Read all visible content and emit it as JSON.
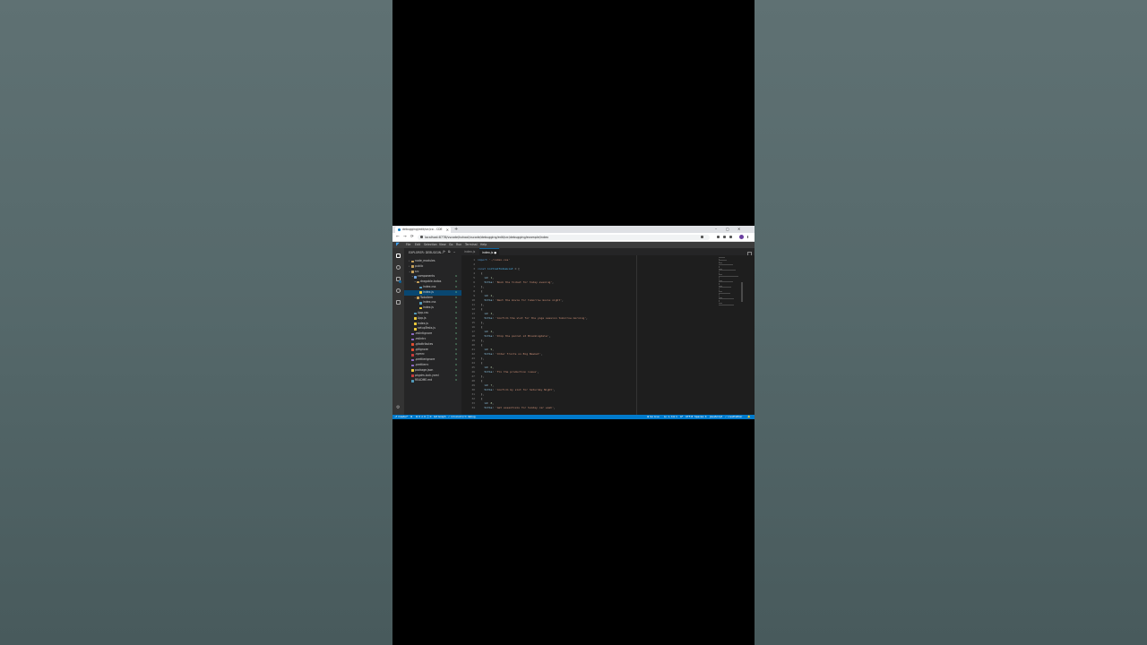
{
  "browser": {
    "tab_title": "debugging/edit/src/co - CDE",
    "new_tab": "+",
    "url": "localhost:8778/vscode/kuhool/vscode/debugging/edit/src/debugging/example/index",
    "controls": {
      "minimize": "–",
      "maximize": "▢",
      "close": "✕",
      "back": "←",
      "forward": "→",
      "reload": "⟳"
    }
  },
  "vscode": {
    "menu": [
      "File",
      "Edit",
      "Selection",
      "View",
      "Go",
      "Run",
      "Terminal",
      "Help"
    ],
    "explorer_title": "EXPLORER: DEBUGGIN...",
    "explorer_actions": "⟳ ⧉ ⌄",
    "tree": [
      {
        "label": "node_modules",
        "indent": 1,
        "chev": "›",
        "color": "#c5a05a",
        "badge": ""
      },
      {
        "label": "public",
        "indent": 1,
        "chev": "›",
        "color": "#c5a05a",
        "badge": ""
      },
      {
        "label": "src",
        "indent": 1,
        "chev": "⌄",
        "color": "#c5a05a",
        "badge": ""
      },
      {
        "label": "components",
        "indent": 2,
        "chev": "⌄",
        "color": "#6ea0d8",
        "badge": "U"
      },
      {
        "label": "dragable-todos",
        "indent": 3,
        "chev": "⌄",
        "color": "#c5a05a",
        "badge": "U"
      },
      {
        "label": "index.css",
        "indent": 4,
        "chev": "",
        "color": "#519aba",
        "badge": "U"
      },
      {
        "label": "index.js",
        "indent": 4,
        "chev": "",
        "color": "#e8c73a",
        "badge": "U",
        "selected": true
      },
      {
        "label": "Todoitem",
        "indent": 3,
        "chev": "⌄",
        "color": "#c5a05a",
        "badge": "U"
      },
      {
        "label": "index.css",
        "indent": 4,
        "chev": "",
        "color": "#519aba",
        "badge": "U"
      },
      {
        "label": "index.js",
        "indent": 4,
        "chev": "",
        "color": "#e8c73a",
        "badge": "U"
      },
      {
        "label": "App.css",
        "indent": 2,
        "chev": "",
        "color": "#519aba",
        "badge": "U"
      },
      {
        "label": "App.js",
        "indent": 2,
        "chev": "",
        "color": "#e8c73a",
        "badge": "U"
      },
      {
        "label": "index.js",
        "indent": 2,
        "chev": "",
        "color": "#e8c73a",
        "badge": "U"
      },
      {
        "label": "setupTests.js",
        "indent": 2,
        "chev": "",
        "color": "#e8c73a",
        "badge": "U"
      },
      {
        "label": ".eslintignore",
        "indent": 1,
        "chev": "",
        "color": "#8f6bc7",
        "badge": "U"
      },
      {
        "label": ".eslintrc",
        "indent": 1,
        "chev": "",
        "color": "#8f6bc7",
        "badge": "U"
      },
      {
        "label": ".gitattributes",
        "indent": 1,
        "chev": "",
        "color": "#e24d30",
        "badge": "U"
      },
      {
        "label": ".gitignore",
        "indent": 1,
        "chev": "",
        "color": "#e24d30",
        "badge": "U"
      },
      {
        "label": ".npmrc",
        "indent": 1,
        "chev": "",
        "color": "#c73c3c",
        "badge": "U"
      },
      {
        "label": ".prettierignore",
        "indent": 1,
        "chev": "",
        "color": "#8f6bc7",
        "badge": "U"
      },
      {
        "label": ".prettierrc",
        "indent": 1,
        "chev": "",
        "color": "#8f6bc7",
        "badge": "U"
      },
      {
        "label": "package.json",
        "indent": 1,
        "chev": "",
        "color": "#e8c73a",
        "badge": "U"
      },
      {
        "label": "pkgdm-lock.yaml",
        "indent": 1,
        "chev": "",
        "color": "#c73c3c",
        "badge": "U"
      },
      {
        "label": "README.md",
        "indent": 1,
        "chev": "",
        "color": "#519aba",
        "badge": "U"
      }
    ],
    "tabs": [
      {
        "label": "index.js",
        "active": false
      },
      {
        "label": "index.js ●",
        "active": true
      }
    ],
    "code": [
      [
        "import './index.css'"
      ],
      [
        ""
      ],
      [
        "const initialTodosList = ["
      ],
      [
        "  {"
      ],
      [
        "    id: 1,"
      ],
      [
        "    title: 'Book the ticket for today evening',"
      ],
      [
        "  },"
      ],
      [
        "  {"
      ],
      [
        "    id: 2,"
      ],
      [
        "    title: 'Rent the movie for tomorrow movie night',"
      ],
      [
        "  },"
      ],
      [
        "  {"
      ],
      [
        "    id: 3,"
      ],
      [
        "    title: 'Confirm the slot for the yoga session tomorrow morning',"
      ],
      [
        "  },"
      ],
      [
        "  {"
      ],
      [
        "    id: 4,"
      ],
      [
        "    title: 'Drop the parcel at Bloomingdale',"
      ],
      [
        "  },"
      ],
      [
        "  {"
      ],
      [
        "    id: 5,"
      ],
      [
        "    title: 'Order fruits on Big Basket',"
      ],
      [
        "  },"
      ],
      [
        "  {"
      ],
      [
        "    id: 6,"
      ],
      [
        "    title: 'Fix the production issue',"
      ],
      [
        "  },"
      ],
      [
        "  {"
      ],
      [
        "    id: 7,"
      ],
      [
        "    title: 'Confirm my slot for Saturday Night',"
      ],
      [
        "  },"
      ],
      [
        "  {"
      ],
      [
        "    id: 8,"
      ],
      [
        "    title: 'Get essentials for Sunday car wash',"
      ]
    ],
    "line_start": 1,
    "status": {
      "left": [
        "⎇ master*",
        "⊗",
        "⊗ 0 ⚠ 0 ⓘ 0",
        "Git Graph",
        "✓ (mnicolrn) ↻ debug"
      ],
      "right": [
        "⊕ Go Live",
        "Ln 1, Col 1",
        "LF",
        "UTF-8",
        "Spaces: 4",
        "JavaScript",
        "✓ Live",
        "Prettier",
        "🔔"
      ]
    }
  }
}
